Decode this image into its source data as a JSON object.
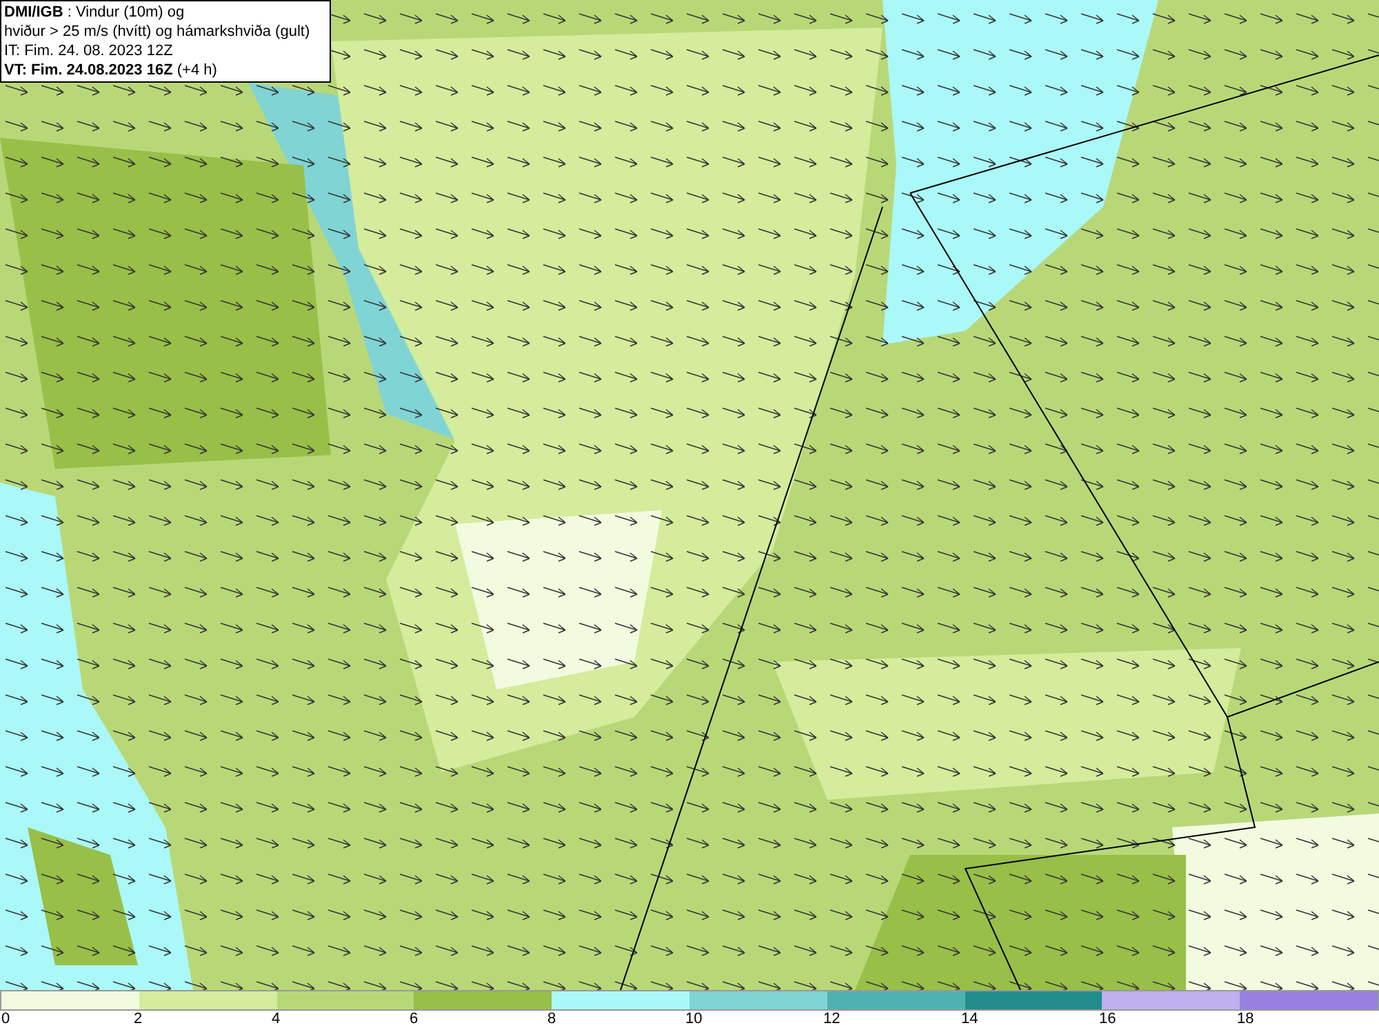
{
  "header": {
    "lines": [
      {
        "text": "**DMI/IGB** : Vindur (10m) og"
      },
      {
        "text": "hviður > 25 m/s (hvítt) og hámarkshviða (gult)"
      },
      {
        "text": "IT: Fim. 24. 08. 2023 12Z"
      },
      {
        "text": "**VT: Fim. 24.08.2023 16Z** (+4 h)"
      }
    ]
  },
  "legend": {
    "bins": [
      {
        "color": "#f2fbe0"
      },
      {
        "color": "#d4ec9c"
      },
      {
        "color": "#b8d878"
      },
      {
        "color": "#98bf48"
      },
      {
        "color": "#aaf8f8"
      },
      {
        "color": "#80d4d4"
      },
      {
        "color": "#50b2b0"
      },
      {
        "color": "#228c8c"
      },
      {
        "color": "#c0b0f0"
      },
      {
        "color": "#9880e0"
      }
    ],
    "labels": [
      "0",
      "2",
      "4",
      "6",
      "8",
      "10",
      "12",
      "14",
      "16",
      "18"
    ]
  }
}
